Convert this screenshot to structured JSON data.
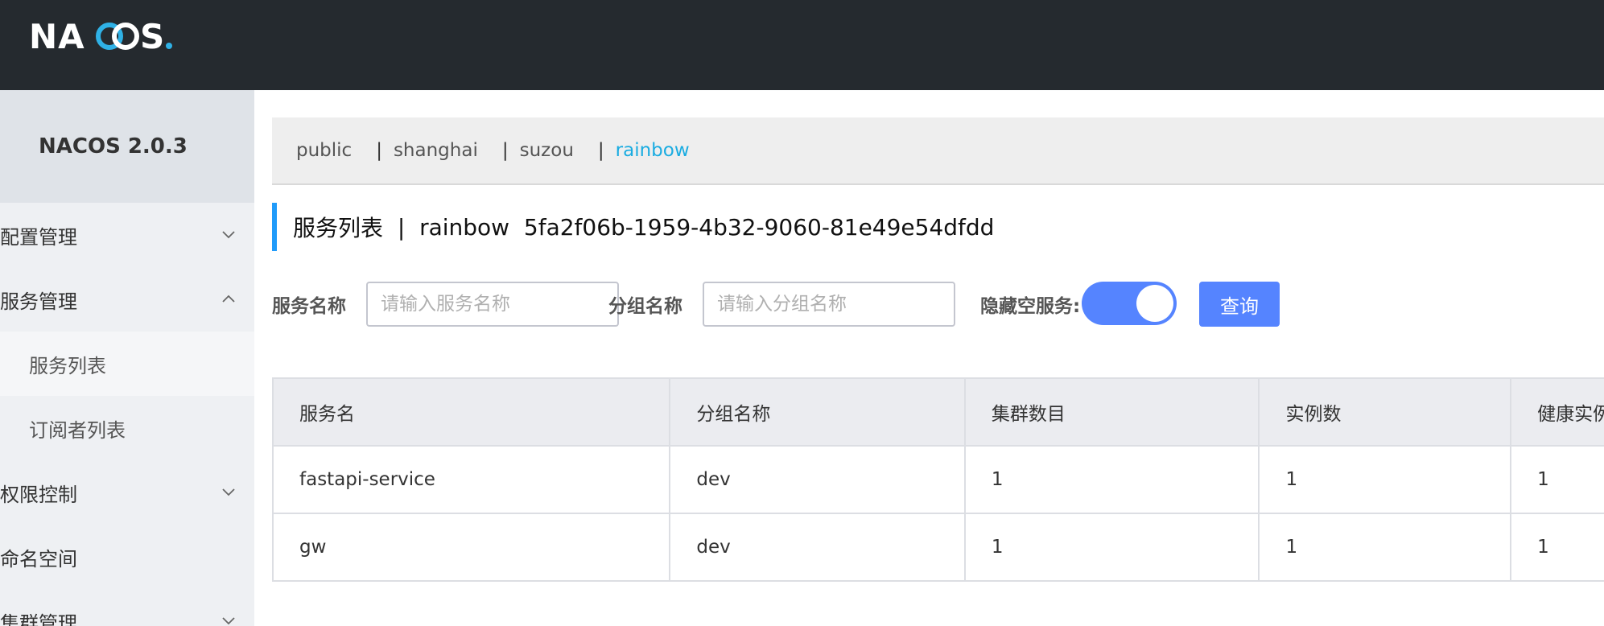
{
  "header": {
    "logo_text": "NACOS"
  },
  "sidebar": {
    "brand": "NACOS 2.0.3",
    "menu": [
      {
        "label": "配置管理",
        "expanded": false
      },
      {
        "label": "服务管理",
        "expanded": true,
        "children": [
          {
            "label": "服务列表",
            "active": true
          },
          {
            "label": "订阅者列表",
            "active": false
          }
        ]
      },
      {
        "label": "权限控制",
        "expanded": false
      },
      {
        "label": "命名空间"
      },
      {
        "label": "集群管理",
        "expanded": false
      }
    ]
  },
  "namespaces": {
    "items": [
      "public",
      "shanghai",
      "suzou",
      "rainbow"
    ],
    "active": "rainbow"
  },
  "page_title": {
    "label": "服务列表",
    "separator": "|",
    "namespace": "rainbow",
    "namespace_id": "5fa2f06b-1959-4b32-9060-81e49e54dfdd"
  },
  "filters": {
    "service_name_label": "服务名称",
    "service_name_placeholder": "请输入服务名称",
    "group_name_label": "分组名称",
    "group_name_placeholder": "请输入分组名称",
    "hide_empty_label": "隐藏空服务:",
    "hide_empty_on": true,
    "query_button": "查询"
  },
  "table": {
    "columns": [
      "服务名",
      "分组名称",
      "集群数目",
      "实例数",
      "健康实例"
    ],
    "rows": [
      [
        "fastapi-service",
        "dev",
        "1",
        "1",
        "1"
      ],
      [
        "gw",
        "dev",
        "1",
        "1",
        "1"
      ]
    ]
  },
  "colors": {
    "topbar": "#252a2f",
    "accent": "#5584ff",
    "ns_active": "#1aace1",
    "title_bar": "#209bfa"
  }
}
